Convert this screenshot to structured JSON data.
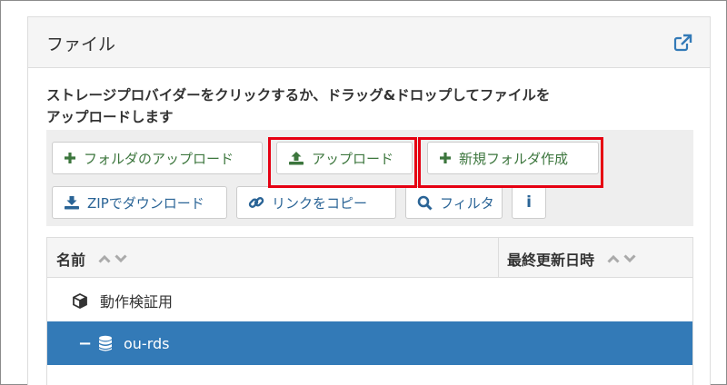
{
  "panel": {
    "title": "ファイル",
    "external_icon": "external-link-icon",
    "instructions_line1": "ストレージプロバイダーをクリックするか、ドラッグ&ドロップしてファイルを",
    "instructions_line2": "アップロードします"
  },
  "toolbar": {
    "upload_folder": "フォルダのアップロード",
    "upload": "アップロード",
    "new_folder": "新規フォルダ作成",
    "zip_download": "ZIPでダウンロード",
    "copy_link": "リンクをコピー",
    "filter": "フィルタ",
    "info": "i"
  },
  "table": {
    "col_name": "名前",
    "col_modified": "最終更新日時",
    "rows": [
      {
        "name": "動作検証用",
        "icon": "cube-icon"
      },
      {
        "name": "ou-rds",
        "icon": "database-icon",
        "toggle": "−"
      }
    ]
  },
  "colors": {
    "accent": "#337ab7",
    "highlight": "#e60012",
    "green": "#3c763d"
  }
}
